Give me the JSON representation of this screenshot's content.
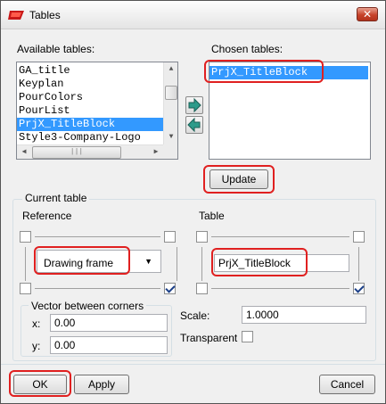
{
  "window": {
    "title": "Tables"
  },
  "available_tables": {
    "label": "Available tables:",
    "items": [
      "GA_title",
      "Keyplan",
      "PourColors",
      "PourList",
      "PrjX_TitleBlock",
      "Style3-Company-Logo"
    ],
    "selected": "PrjX_TitleBlock"
  },
  "chosen_tables": {
    "label": "Chosen tables:",
    "items": [
      "PrjX_TitleBlock"
    ]
  },
  "buttons": {
    "update": "Update",
    "ok": "OK",
    "apply": "Apply",
    "cancel": "Cancel"
  },
  "current_table": {
    "title": "Current table",
    "reference_label": "Reference",
    "table_label": "Table",
    "reference_value": "Drawing frame",
    "table_value": "PrjX_TitleBlock",
    "reference_corners": {
      "top_left": false,
      "top_right": false,
      "bottom_left": false,
      "bottom_right": true
    },
    "table_corners": {
      "top_left": false,
      "top_right": false,
      "bottom_left": false,
      "bottom_right": true
    }
  },
  "vector": {
    "title": "Vector between corners",
    "x_label": "x:",
    "x_value": "0.00",
    "y_label": "y:",
    "y_value": "0.00"
  },
  "scale": {
    "label": "Scale:",
    "value": "1.0000"
  },
  "transparent": {
    "label": "Transparent",
    "checked": false
  },
  "colors": {
    "highlight": "#e02020",
    "selection": "#3399ff",
    "close_button": "#c7432a"
  }
}
